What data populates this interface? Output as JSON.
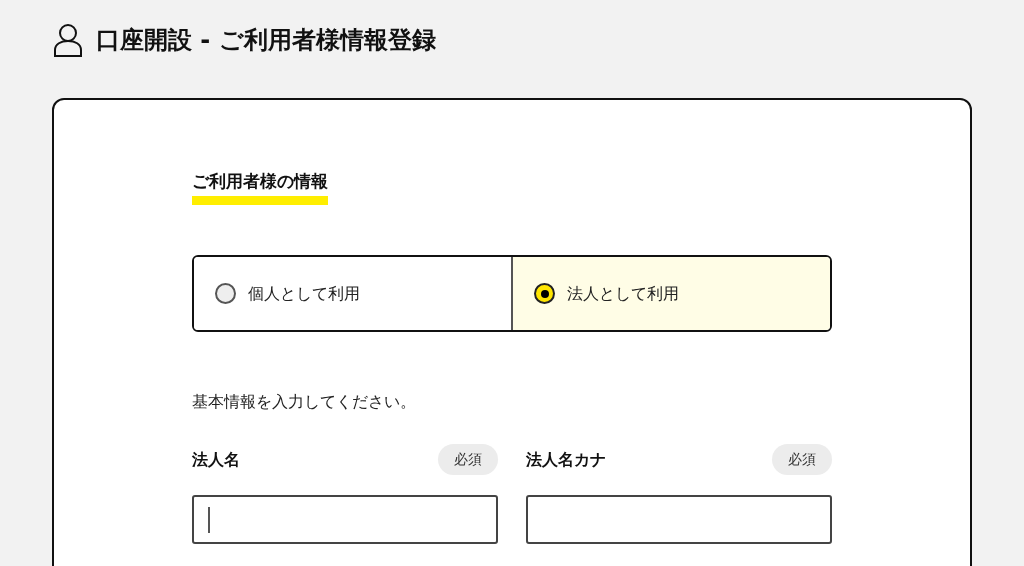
{
  "page": {
    "title": "口座開設 - ご利用者様情報登録"
  },
  "section": {
    "heading": "ご利用者様の情報"
  },
  "user_types": [
    {
      "label": "個人として利用",
      "selected": false
    },
    {
      "label": "法人として利用",
      "selected": true
    }
  ],
  "instruction": "基本情報を入力してください。",
  "fields": [
    {
      "label": "法人名",
      "badge": "必須",
      "focused": true
    },
    {
      "label": "法人名カナ",
      "badge": "必須",
      "focused": false
    }
  ]
}
